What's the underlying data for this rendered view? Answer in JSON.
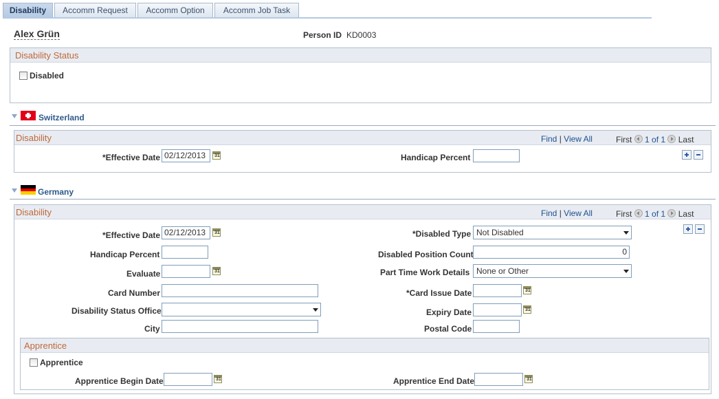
{
  "tabs": [
    "Disability",
    "Accomm Request",
    "Accomm Option",
    "Accomm Job Task"
  ],
  "person": {
    "name": "Alex Grün",
    "id_label": "Person ID",
    "id_value": "KD0003"
  },
  "status_box": {
    "title": "Disability Status",
    "disabled_label": "Disabled"
  },
  "switzerland": {
    "heading": "Switzerland",
    "box_title": "Disability",
    "nav": {
      "find": "Find",
      "sep": "|",
      "view_all": "View All",
      "first": "First",
      "count": "1 of 1",
      "last": "Last"
    },
    "effective_date_label": "*Effective Date",
    "effective_date": "02/12/2013",
    "handicap_label": "Handicap Percent",
    "handicap_value": ""
  },
  "germany": {
    "heading": "Germany",
    "box_title": "Disability",
    "nav": {
      "find": "Find",
      "sep": "|",
      "view_all": "View All",
      "first": "First",
      "count": "1 of 1",
      "last": "Last"
    },
    "effective_date_label": "*Effective Date",
    "effective_date": "02/12/2013",
    "handicap_label": "Handicap Percent",
    "evaluate_label": "Evaluate",
    "card_number_label": "Card Number",
    "status_office_label": "Disability Status Office",
    "city_label": "City",
    "disabled_type_label": "*Disabled Type",
    "disabled_type": "Not Disabled",
    "position_count_label": "Disabled Position Count",
    "position_count": "0",
    "part_time_label": "Part Time Work Details",
    "part_time": "None or Other",
    "card_issue_label": "*Card Issue Date",
    "expiry_label": "Expiry Date",
    "postal_label": "Postal Code"
  },
  "apprentice": {
    "title": "Apprentice",
    "checkbox_label": "Apprentice",
    "begin_label": "Apprentice Begin Date",
    "end_label": "Apprentice End Date"
  },
  "calendar_glyph": "31"
}
